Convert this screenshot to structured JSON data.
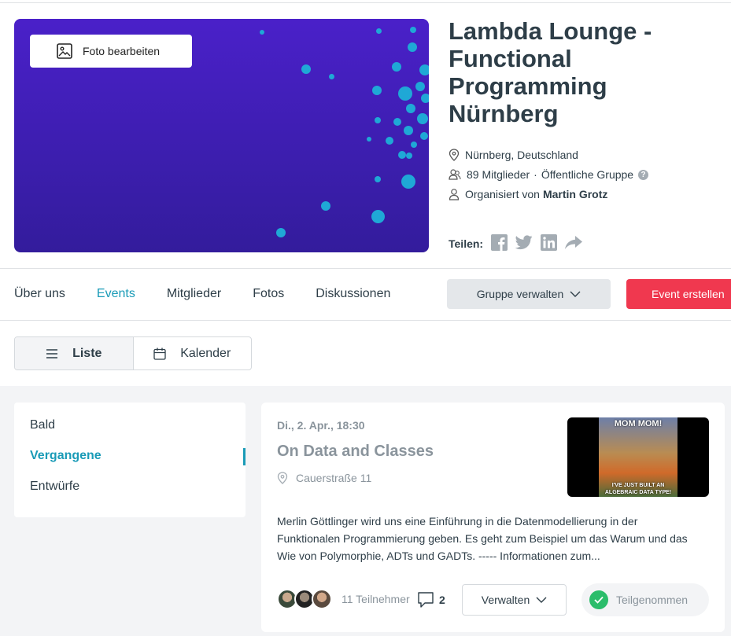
{
  "header": {
    "edit_photo_label": "Foto bearbeiten",
    "title": "Lambda Lounge - Functional Programming Nürnberg",
    "location": "Nürnberg, Deutschland",
    "members": "89 Mitglieder",
    "separator": "·",
    "group_type": "Öffentliche Gruppe",
    "organized_by_prefix": "Organisiert von",
    "organizer": "Martin Grotz",
    "share_label": "Teilen:",
    "share_icons": [
      "facebook-icon",
      "twitter-icon",
      "linkedin-icon",
      "share-arrow-icon"
    ]
  },
  "nav": {
    "tabs": [
      {
        "label": "Über uns"
      },
      {
        "label": "Events",
        "active": true
      },
      {
        "label": "Mitglieder"
      },
      {
        "label": "Fotos"
      },
      {
        "label": "Diskussionen"
      }
    ],
    "manage_label": "Gruppe verwalten",
    "create_label": "Event erstellen"
  },
  "view_toggle": {
    "list_label": "Liste",
    "calendar_label": "Kalender",
    "selected": "Liste"
  },
  "sidebar": {
    "items": [
      {
        "label": "Bald"
      },
      {
        "label": "Vergangene",
        "active": true
      },
      {
        "label": "Entwürfe"
      }
    ]
  },
  "event": {
    "date": "Di., 2. Apr., 18:30",
    "title": "On Data and Classes",
    "location": "Cauerstraße 11",
    "image_caption_top": "MOM MOM!",
    "image_caption_bottom": "I'VE JUST BUILT AN ALGEBRAIC DATA TYPE!",
    "description": "Merlin Göttlinger wird uns eine Einführung in die Datenmodellierung in der Funktionalen Programmierung geben. Es geht zum Beispiel um das Warum und das Wie von Polymorphie, ADTs und GADTs. ----- Informationen zum...",
    "attendees": "11 Teilnehmer",
    "comments": "2",
    "manage_label": "Verwalten",
    "status_label": "Teilgenommen"
  },
  "colors": {
    "accent": "#1a9bb7",
    "create": "#f0384f",
    "banner": "#4a20c9",
    "success": "#2bbd6b"
  }
}
